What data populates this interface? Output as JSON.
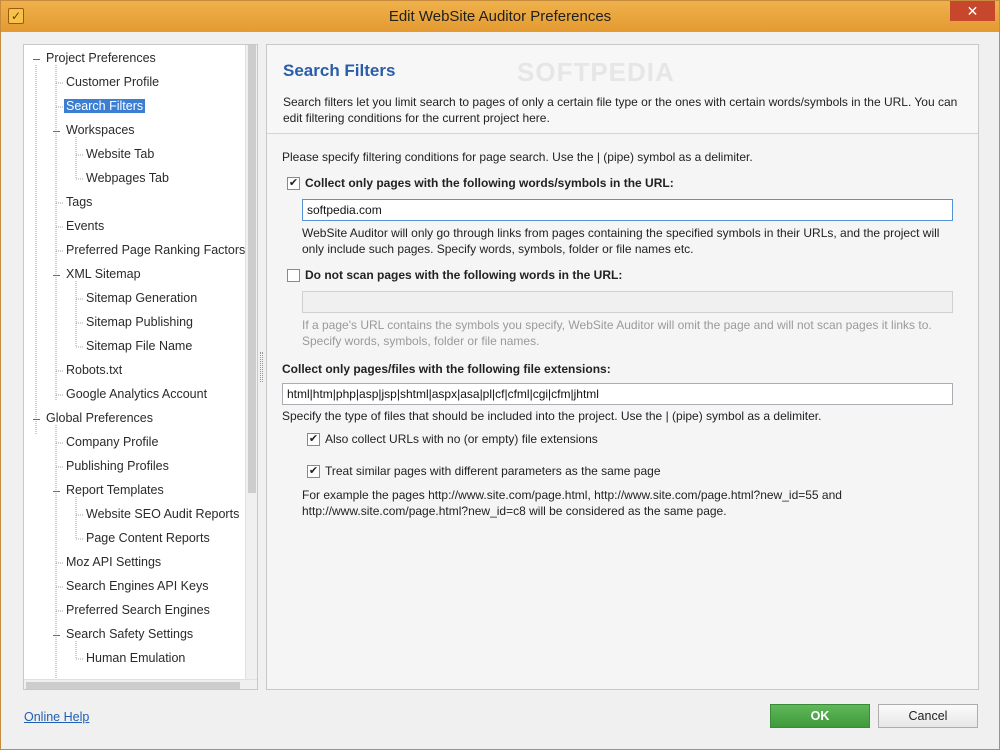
{
  "window": {
    "title": "Edit WebSite Auditor Preferences",
    "close_glyph": "✕",
    "app_icon": "checkbox-app-icon"
  },
  "tree": {
    "items": [
      {
        "label": "Project Preferences"
      },
      {
        "label": "Customer Profile"
      },
      {
        "label": "Search Filters",
        "selected": true
      },
      {
        "label": "Workspaces"
      },
      {
        "label": "Website Tab"
      },
      {
        "label": "Webpages Tab"
      },
      {
        "label": "Tags"
      },
      {
        "label": "Events"
      },
      {
        "label": "Preferred Page Ranking Factors"
      },
      {
        "label": "XML Sitemap"
      },
      {
        "label": "Sitemap Generation"
      },
      {
        "label": "Sitemap Publishing"
      },
      {
        "label": "Sitemap File Name"
      },
      {
        "label": "Robots.txt"
      },
      {
        "label": "Google Analytics Account"
      },
      {
        "label": "Global Preferences"
      },
      {
        "label": "Company Profile"
      },
      {
        "label": "Publishing Profiles"
      },
      {
        "label": "Report Templates"
      },
      {
        "label": "Website SEO Audit Reports"
      },
      {
        "label": "Page Content Reports"
      },
      {
        "label": "Moz API Settings"
      },
      {
        "label": "Search Engines API Keys"
      },
      {
        "label": "Preferred Search Engines"
      },
      {
        "label": "Search Safety Settings"
      },
      {
        "label": "Human Emulation"
      }
    ]
  },
  "header": {
    "title": "Search Filters",
    "watermark": "SOFTPEDIA",
    "description": "Search filters let you limit search to pages of only a certain file type or the ones with certain words/symbols in the URL. You can edit filtering conditions for the current project here."
  },
  "form": {
    "intro": "Please specify filtering conditions for page search. Use the | (pipe) symbol as a delimiter.",
    "include_words": {
      "checked": true,
      "check_glyph": "✔",
      "label": "Collect only pages with the following words/symbols in the URL:",
      "value": "softpedia.com",
      "help": "WebSite Auditor will only go through links from pages containing the specified symbols in their URLs, and the project will only include such pages. Specify words, symbols, folder or file names etc."
    },
    "exclude_words": {
      "checked": false,
      "label": "Do not scan pages with the following words in the URL:",
      "value": "",
      "help": "If a page's URL contains the symbols you specify, WebSite Auditor will omit the page and will not scan pages it links to. Specify words, symbols, folder or file names."
    },
    "extensions": {
      "label": "Collect only pages/files with the following file extensions:",
      "value": "html|htm|php|asp|jsp|shtml|aspx|asa|pl|cf|cfml|cgi|cfm|jhtml",
      "help": "Specify the type of files that should be included into the project. Use the | (pipe) symbol as a delimiter."
    },
    "no_extension": {
      "checked": true,
      "check_glyph": "✔",
      "label": "Also collect URLs with no (or empty) file extensions"
    },
    "similar_pages": {
      "checked": true,
      "check_glyph": "✔",
      "label": "Treat similar pages with different parameters as the same page",
      "help": "For example the pages http://www.site.com/page.html, http://www.site.com/page.html?new_id=55 and http://www.site.com/page.html?new_id=c8 will be considered as the same page."
    }
  },
  "footer": {
    "online_help": "Online Help",
    "ok": "OK",
    "cancel": "Cancel"
  },
  "colors": {
    "titlebar": "#e8a23c",
    "selection": "#3c7fd2",
    "header_title": "#2b5ea8",
    "ok_button": "#4aa746",
    "link": "#1f5fb3"
  }
}
